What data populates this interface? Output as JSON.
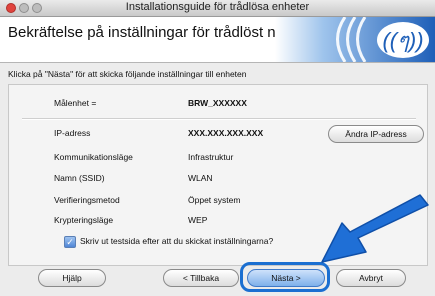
{
  "window": {
    "title": "Installationsguide för trådlösa enheter"
  },
  "header": {
    "title": "Bekräftelse på inställningar för trådlöst nätverk"
  },
  "instruction": "Klicka på \"Nästa\" för att skicka följande inställningar till enheten",
  "settings": [
    {
      "label": "Målenhet =",
      "value": "BRW_XXXXXX"
    },
    {
      "label": "IP-adress",
      "value": "XXX.XXX.XXX.XXX"
    },
    {
      "label": "Kommunikationsläge",
      "value": "Infrastruktur"
    },
    {
      "label": "Namn (SSID)",
      "value": "WLAN"
    },
    {
      "label": "Verifieringsmetod",
      "value": "Öppet system"
    },
    {
      "label": "Krypteringsläge",
      "value": "WEP"
    }
  ],
  "change_ip_button": "Ändra IP-adress",
  "print_checkbox": {
    "label": "Skriv ut testsida efter att du skickat inställningarna?",
    "checked": true
  },
  "buttons": {
    "help": "Hjälp",
    "back": "< Tillbaka",
    "next": "Nästa >",
    "cancel": "Avbryt"
  },
  "colors": {
    "highlight": "#1b6fd1",
    "arrow": "#1f6fd6"
  }
}
